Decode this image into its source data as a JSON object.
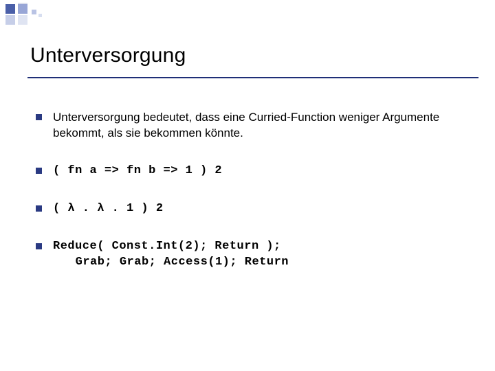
{
  "slide": {
    "title": "Unterversorgung",
    "bullets": [
      {
        "text": "Unterversorgung bedeutet, dass eine Curried-Function weniger Argumente bekommt, als sie bekommen könnte.",
        "mono": false
      },
      {
        "text": "( fn a => fn b => 1 ) 2",
        "mono": true
      },
      {
        "text": "( λ . λ . 1 ) 2",
        "mono": true
      },
      {
        "line1": "Reduce( Const.Int(2); Return );",
        "line2": "Grab; Grab; Access(1); Return",
        "mono": true,
        "two_line": true
      }
    ]
  }
}
